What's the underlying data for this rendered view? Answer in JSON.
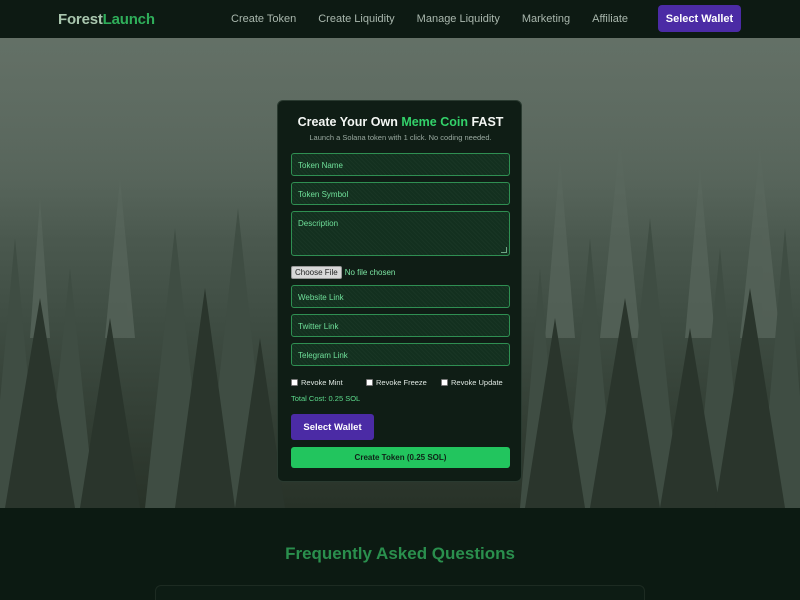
{
  "brand": {
    "part1": "Forest",
    "part2": "Launch"
  },
  "nav": {
    "links": [
      "Create Token",
      "Create Liquidity",
      "Manage Liquidity",
      "Marketing",
      "Affiliate"
    ],
    "wallet_button": "Select Wallet"
  },
  "form": {
    "title_pre": "Create Your Own ",
    "title_accent": "Meme Coin",
    "title_post": " FAST",
    "subtitle": "Launch a Solana token with 1 click. No coding needed.",
    "token_name_placeholder": "Token Name",
    "token_symbol_placeholder": "Token Symbol",
    "description_placeholder": "Description",
    "file_button": "Choose File",
    "file_status": "No file chosen",
    "website_placeholder": "Website Link",
    "twitter_placeholder": "Twitter Link",
    "telegram_placeholder": "Telegram Link",
    "checkboxes": [
      {
        "label": "Revoke Mint",
        "checked": false
      },
      {
        "label": "Revoke Freeze",
        "checked": false
      },
      {
        "label": "Revoke Update",
        "checked": false
      }
    ],
    "total_cost": "Total Cost: 0.25 SOL",
    "wallet_button": "Select Wallet",
    "create_button": "Create Token (0.25 SOL)"
  },
  "faq": {
    "title": "Frequently Asked Questions"
  },
  "colors": {
    "accent_green": "#22c55e",
    "wallet_purple": "#4b2ba5",
    "background": "#0c1a12"
  }
}
